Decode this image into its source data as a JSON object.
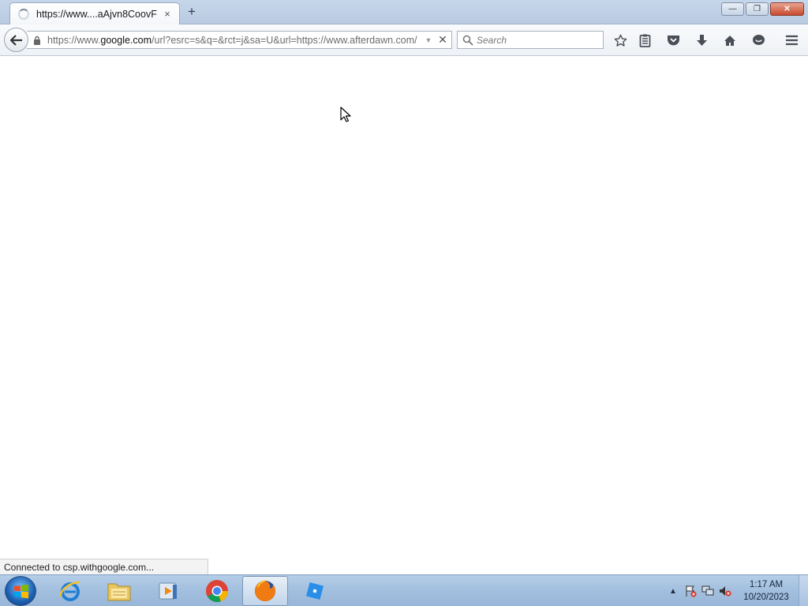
{
  "tab": {
    "title": "https://www....aAjvn8CoovF",
    "close_glyph": "×",
    "new_tab_glyph": "+"
  },
  "window_controls": {
    "minimize": "—",
    "maximize": "❐",
    "close": "✕"
  },
  "urlbar": {
    "prefix": "https://www.",
    "domain": "google.com",
    "suffix": "/url?esrc=s&q=&rct=j&sa=U&url=https://www.afterdawn.com/",
    "dropdown_glyph": "▼",
    "stop_glyph": "✕"
  },
  "search": {
    "placeholder": "Search"
  },
  "toolbar_icons": [
    "star-icon",
    "reading-list-icon",
    "pocket-icon",
    "download-icon",
    "home-icon",
    "chat-icon",
    "menu-icon"
  ],
  "status": {
    "text": "Connected to csp.withgoogle.com..."
  },
  "taskbar": {
    "apps": [
      "internet-explorer-icon",
      "file-explorer-icon",
      "media-player-icon",
      "chrome-icon",
      "firefox-icon",
      "roblox-studio-icon"
    ],
    "active_app": "firefox-icon",
    "tray_expand_glyph": "▲"
  },
  "clock": {
    "time": "1:17 AM",
    "date": "10/20/2023"
  },
  "colors": {
    "accent": "#1c5fb0",
    "taskbar": "#a3bfdf",
    "titlebar": "#c6d6ea"
  }
}
